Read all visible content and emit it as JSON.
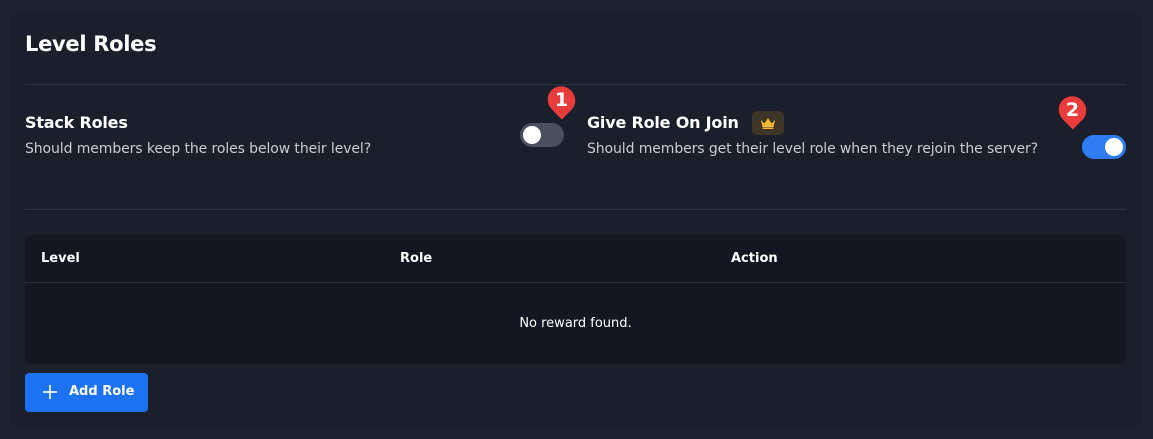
{
  "card": {
    "title": "Level Roles"
  },
  "settings": [
    {
      "title": "Stack Roles",
      "description": "Should members keep the roles below their level?",
      "enabled": false,
      "badge": "1"
    },
    {
      "title": "Give Role On Join",
      "description": "Should members get their level role when they rejoin the server?",
      "enabled": true,
      "badge": "2",
      "premium_icon": "crown-icon"
    }
  ],
  "table": {
    "columns": [
      "Level",
      "Role",
      "Action"
    ],
    "empty_text": "No reward found."
  },
  "add_button": {
    "label": "Add Role",
    "icon": "plus-icon"
  },
  "colors": {
    "accent": "#1d72f2",
    "toggle_on": "#2f7bf2",
    "badge": "#e83c3c",
    "premium": "#f4b731"
  }
}
